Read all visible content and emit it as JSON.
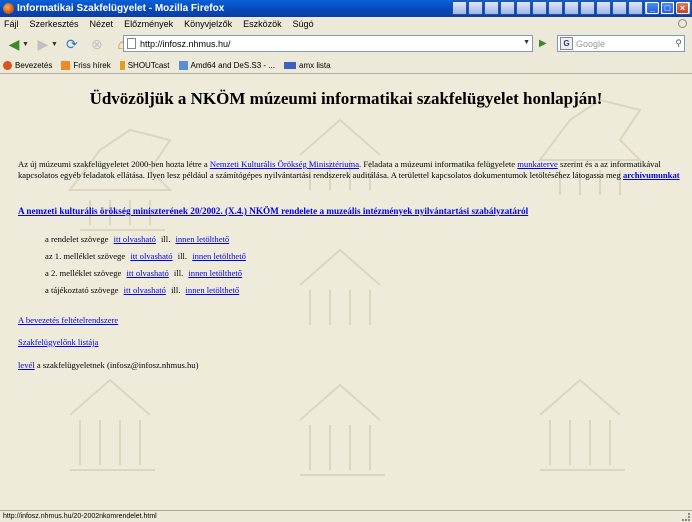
{
  "window": {
    "title": "Informatikai Szakfelügyelet - Mozilla Firefox",
    "minimize": "_",
    "maximize": "□",
    "close": "×"
  },
  "menu": [
    "Fájl",
    "Szerkesztés",
    "Nézet",
    "Előzmények",
    "Könyvjelzők",
    "Eszközök",
    "Súgó"
  ],
  "nav": {
    "url": "http://infosz.nhmus.hu/",
    "search_placeholder": "Google",
    "icons": [
      "back-arrow-icon",
      "forward-arrow-icon",
      "reload-icon",
      "stop-icon",
      "home-icon"
    ]
  },
  "bookmarks": [
    {
      "label": "Bevezetés",
      "icon": "firefox-icon",
      "color": "#d9531e"
    },
    {
      "label": "Friss hírek",
      "icon": "rss-icon",
      "color": "#f08a24"
    },
    {
      "label": "SHOUTcast",
      "icon": "shoutcast-icon",
      "color": "#e0a020"
    },
    {
      "label": "Amd64 and DeS.S3 - ...",
      "icon": "page-icon",
      "color": "#5a8fd0"
    },
    {
      "label": "amx lista",
      "icon": "list-icon",
      "color": "#4060c0"
    }
  ],
  "page": {
    "title": "Üdvözöljük a NKÖM múzeumi informatikai szakfelügyelet honlapján!",
    "intro": {
      "t1": "Az új múzeumi szakfelügyeletet 2000-ben hozta létre a ",
      "link1": "Nemzeti Kulturális Örökség Minisztériuma",
      "t2": ". Feladata a múzeumi informatika felügyelete ",
      "link2": "munkaterve",
      "t3": " szerint és a az informatikával kapcsolatos egyéb feladatok ellátása. Ilyen lesz például a számítógépes nyilvántartási rendszerek auditálása. A területtel kapcsolatos dokumentumok letöltéséhez látogassa meg ",
      "link3": "archívumunkat"
    },
    "rendelet_link": "A nemzeti kulturális örökség miniszterének 20/2002. (X.4.) NKÖM rendelete a muzeális intézmények nyilvántartási szabályzatáról",
    "documents": [
      {
        "label": "a rendelet szövege",
        "read": "itt olvasható",
        "sep": "ill.",
        "download": "innen letölthető"
      },
      {
        "label": "az 1. melléklet szövege",
        "read": "itt olvasható",
        "sep": "ill.",
        "download": "innen letölthető"
      },
      {
        "label": "a 2. melléklet szövege",
        "read": "itt olvasható",
        "sep": "ill.",
        "download": "innen letölthető"
      },
      {
        "label": "a tájékoztató szövege",
        "read": "itt olvasható",
        "sep": "ill.",
        "download": "innen letölthető"
      }
    ],
    "link_bevezetes": "A bevezetés feltételrendszere",
    "link_historia": "Szakfelügyelőnk listája",
    "contact": {
      "link": "levél",
      "text": " a szakfelügyeletnek (infosz@infosz.nhmus.hu)"
    }
  },
  "status": "http://infosz.nhmus.hu/20-2002nkomrendelet.html",
  "colors": {
    "link": "#0000ee",
    "titlebar": "#0a50c8",
    "background": "#efebdb"
  }
}
